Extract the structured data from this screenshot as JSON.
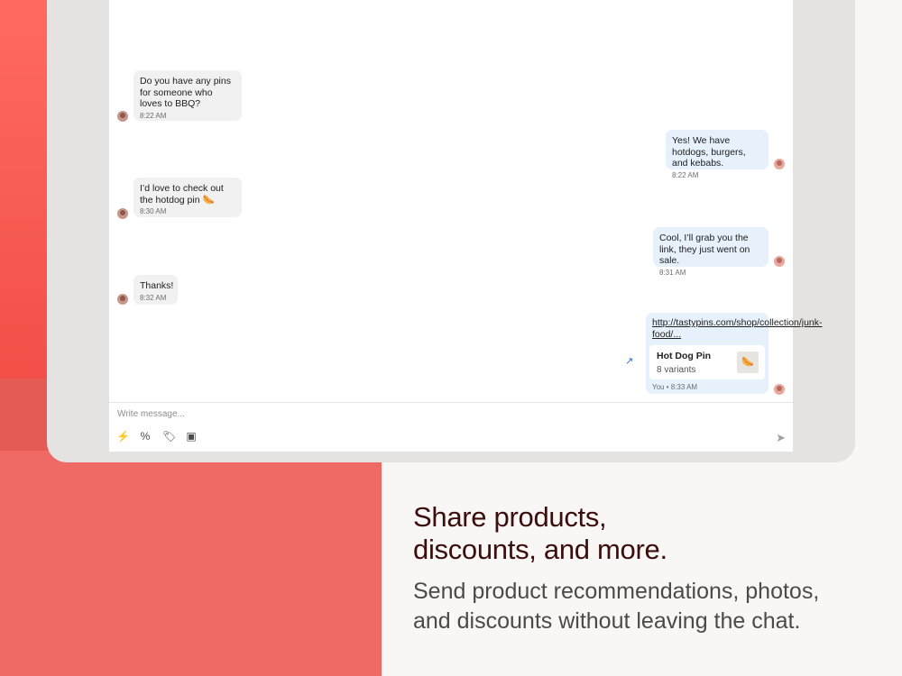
{
  "messages": [
    {
      "side": "in",
      "text": "Do you have any pins for someone who loves to BBQ?",
      "time": "8:22 AM"
    },
    {
      "side": "out",
      "text": "Yes! We have hotdogs, burgers, and kebabs.",
      "time": "8:22 AM"
    },
    {
      "side": "in",
      "text": "I’d love to check out the hotdog pin 🌭",
      "time": "8:30 AM"
    },
    {
      "side": "out",
      "text": "Cool, I’ll grab you the link, they just went on sale.",
      "time": "8:31 AM"
    },
    {
      "side": "in",
      "text": "Thanks!",
      "time": "8:32 AM"
    }
  ],
  "product_message": {
    "link": "http://tastypins.com/shop/collection/junk-food/...",
    "product_title": "Hot Dog Pin",
    "product_variants": "8 variants",
    "thumb": "🌭",
    "meta": "You • 8:33 AM"
  },
  "composer": {
    "placeholder": "Write message...",
    "icons": [
      "lightning-icon",
      "discount-icon",
      "tag-icon",
      "image-icon",
      "send-icon"
    ]
  },
  "marketing": {
    "headline_line1": "Share products,",
    "headline_line2": "discounts, and more.",
    "subline_line1": "Send product recommendations, photos,",
    "subline_line2": "and discounts without leaving the chat."
  },
  "colors": {
    "brand_red": "#ef6a64",
    "headline": "#3b0d0c",
    "bubble_in": "#f1f1f1",
    "bubble_out": "#e6f1fb"
  }
}
